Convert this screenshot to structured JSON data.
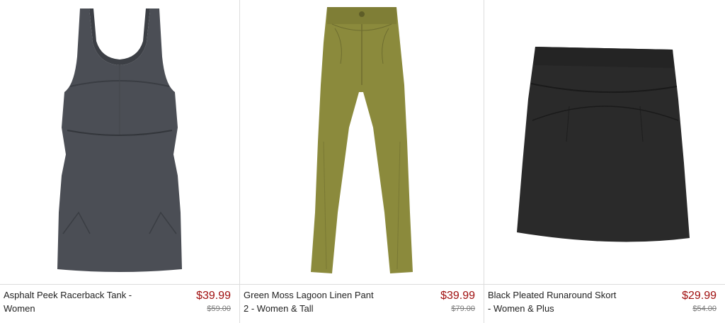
{
  "products": [
    {
      "name_line1": "Asphalt Peek Racerback Tank -",
      "name_line2": "Women",
      "sale_price": "$39.99",
      "original_price": "$59.00",
      "image_icon": "racerback-tank-image",
      "color": "#4b4e55"
    },
    {
      "name_line1": "Green Moss Lagoon Linen Pant",
      "name_line2": "2 - Women & Tall",
      "sale_price": "$39.99",
      "original_price": "$79.00",
      "image_icon": "linen-pant-image",
      "color": "#8b8a3c"
    },
    {
      "name_line1": "Black Pleated Runaround Skort",
      "name_line2": "- Women & Plus",
      "sale_price": "$29.99",
      "original_price": "$54.00",
      "image_icon": "skort-image",
      "color": "#2a2a2a"
    }
  ],
  "colors": {
    "sale_price": "#a01010",
    "original_price": "#777777",
    "divider": "#dddddd"
  }
}
